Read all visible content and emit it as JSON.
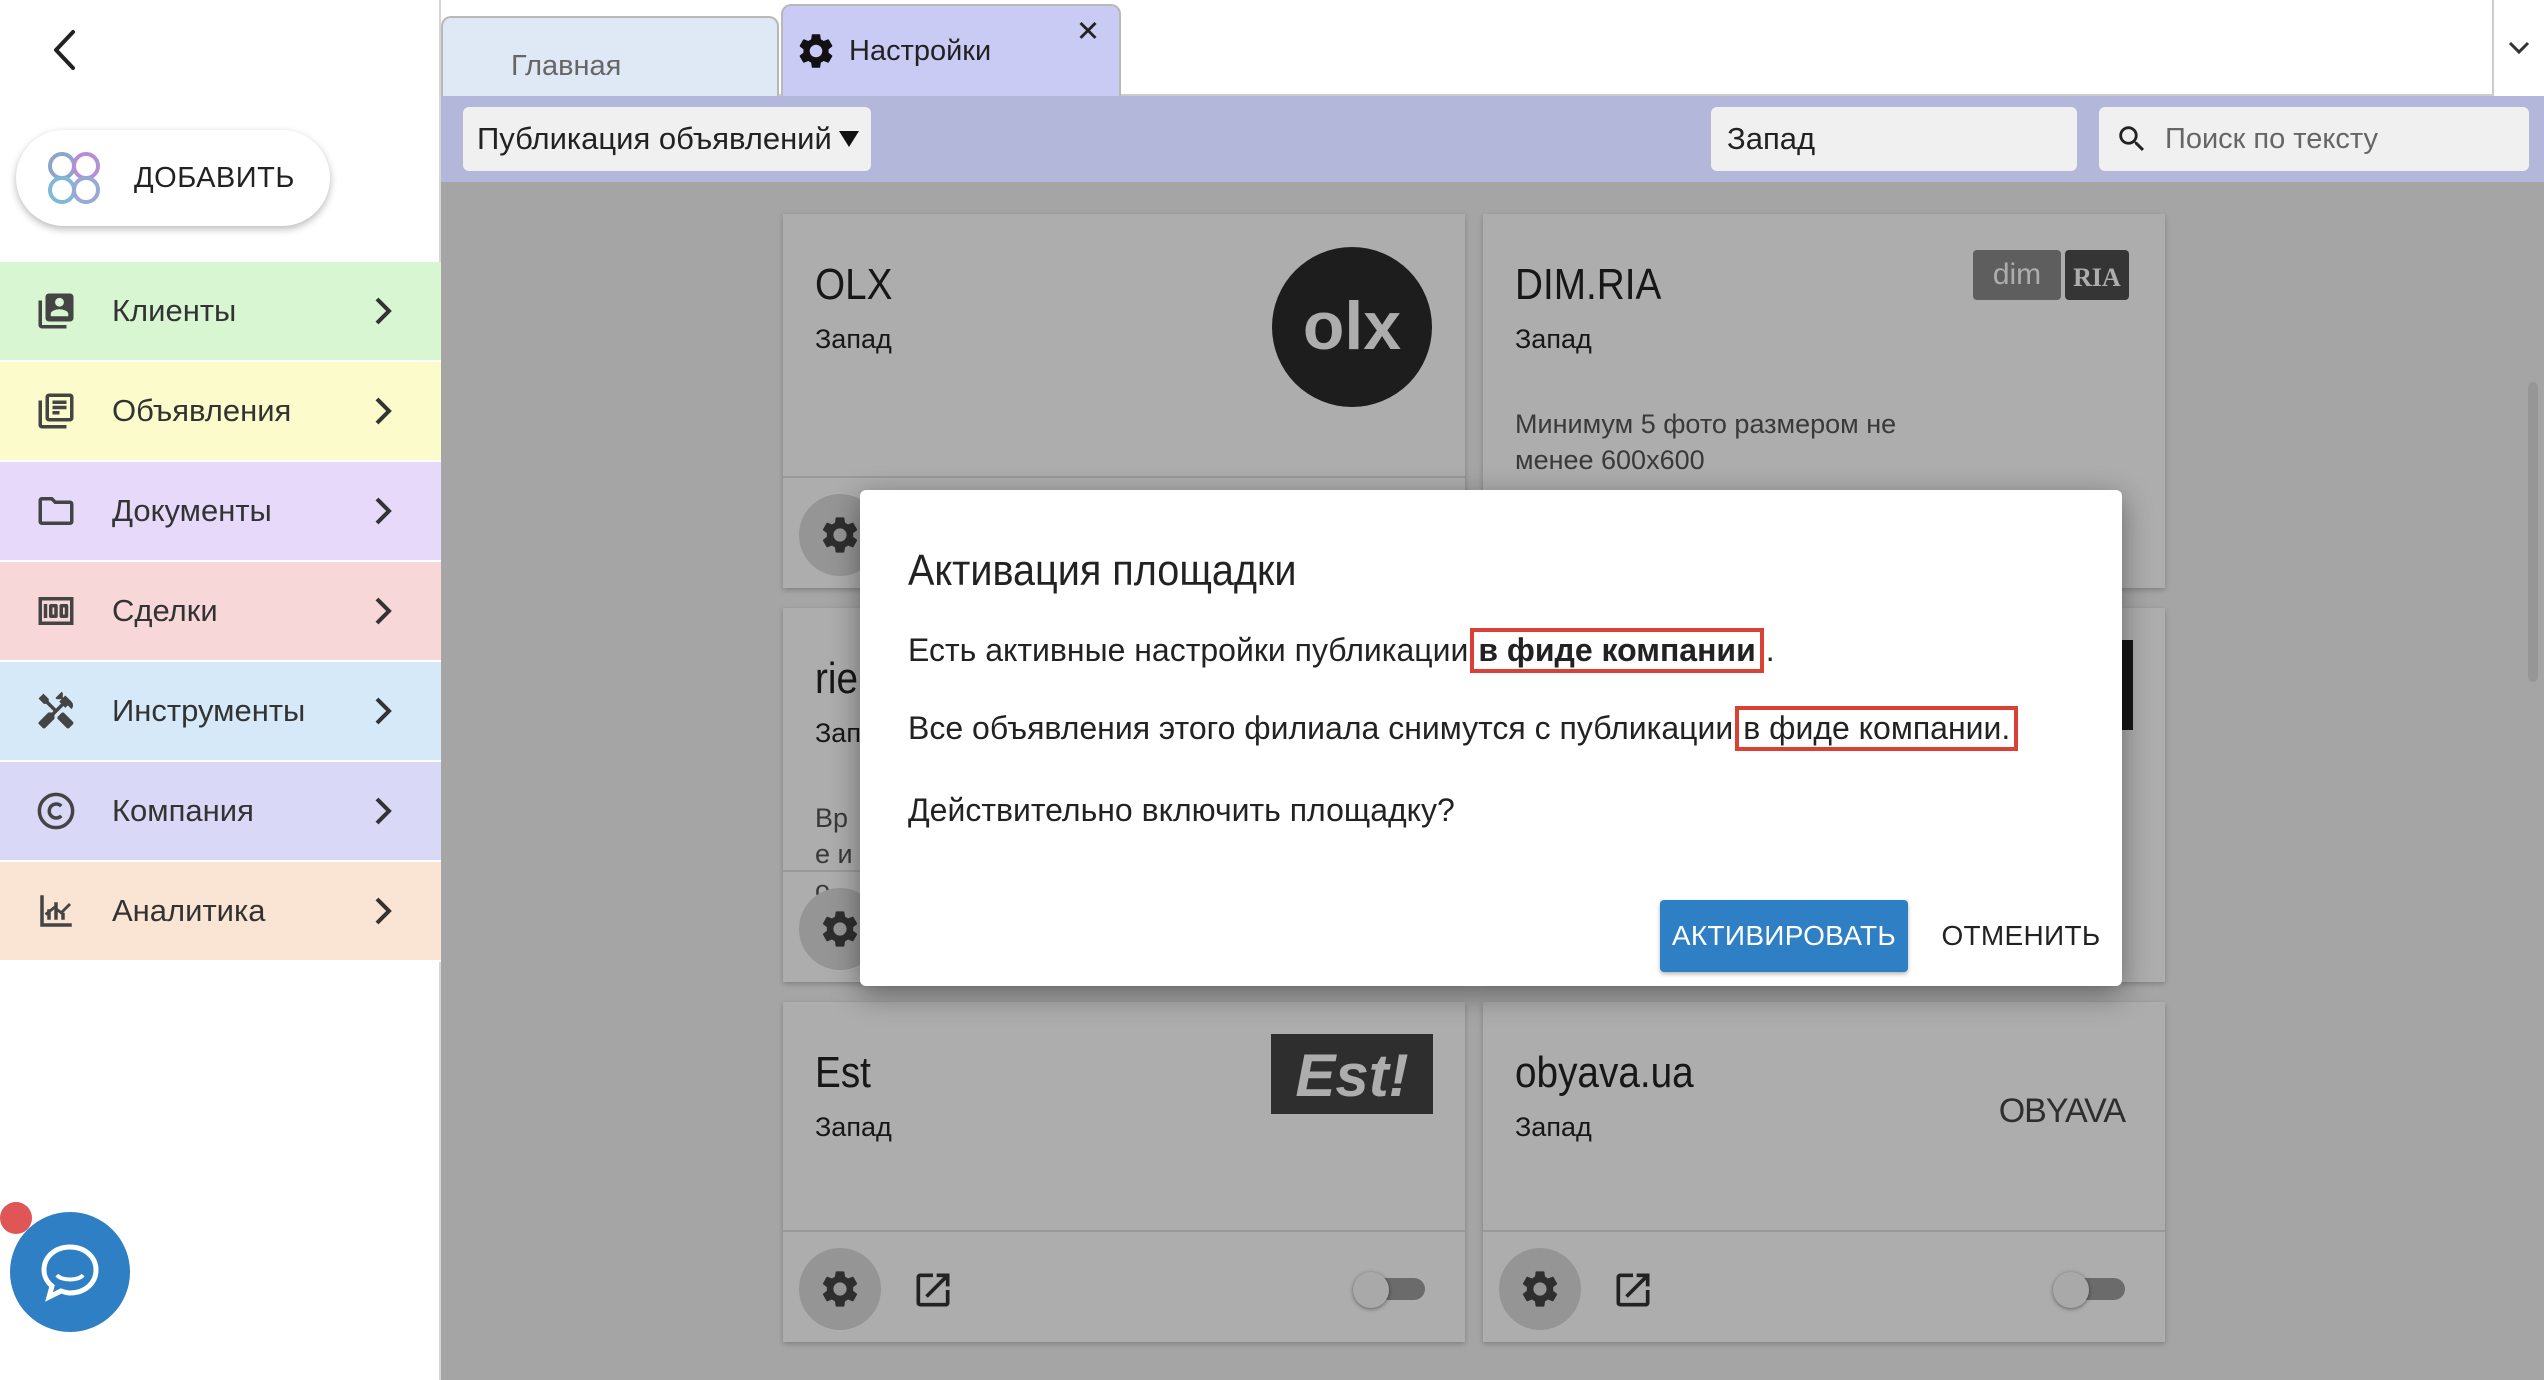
{
  "sidebar": {
    "add_label": "ДОБАВИТЬ",
    "items": [
      {
        "label": "Клиенты",
        "color": "#d8f6d2",
        "icon": "contacts-icon"
      },
      {
        "label": "Объявления",
        "color": "#fbfbcc",
        "icon": "listings-icon"
      },
      {
        "label": "Документы",
        "color": "#e7d9f9",
        "icon": "folder-icon"
      },
      {
        "label": "Сделки",
        "color": "#f8d7d9",
        "icon": "money-icon"
      },
      {
        "label": "Инструменты",
        "color": "#d6e9f8",
        "icon": "tools-icon"
      },
      {
        "label": "Компания",
        "color": "#d9d8f7",
        "icon": "copyright-icon"
      },
      {
        "label": "Аналитика",
        "color": "#fae5d4",
        "icon": "analytics-icon"
      }
    ]
  },
  "tabs": {
    "main": "Главная",
    "settings": "Настройки",
    "close": "✕"
  },
  "filters": {
    "publication": "Публикация объявлений",
    "region": "Запад",
    "search_placeholder": "Поиск по тексту"
  },
  "cards": [
    {
      "name": "OLX",
      "region": "Запад",
      "desc": "",
      "logo": "olx-logo"
    },
    {
      "name": "DIM.RIA",
      "region": "Запад",
      "desc": "Минимум 5 фото размером не менее 600х600",
      "logo": "dimria-logo"
    },
    {
      "name": "rie",
      "region": "Зап",
      "desc": "Вре и о",
      "logo": "rieltor-logo"
    },
    {
      "name": "",
      "region": "",
      "desc": "",
      "logo": ""
    },
    {
      "name": "Est",
      "region": "Запад",
      "desc": "",
      "logo": "est-logo"
    },
    {
      "name": "obyava.ua",
      "region": "Запад",
      "desc": "",
      "logo": "obyava-logo"
    }
  ],
  "logos": {
    "olx": "olx",
    "dim": "dim",
    "ria": "RIA",
    "est": "Est!",
    "obyava": "OBYAVA"
  },
  "dialog": {
    "title": "Активация площадки",
    "line1_pre": "Есть активные настройки публикации",
    "line1_hl": "в фиде компании",
    "line1_post": ".",
    "line2_pre": "Все объявления этого филиала снимутся с публикации",
    "line2_hl": "в фиде компании.",
    "line3": "Действительно включить площадку?",
    "activate": "АКТИВИРОВАТЬ",
    "cancel": "ОТМЕНИТЬ"
  },
  "colors": {
    "accent": "#2f7fc4",
    "highlight_border": "#d94134"
  }
}
